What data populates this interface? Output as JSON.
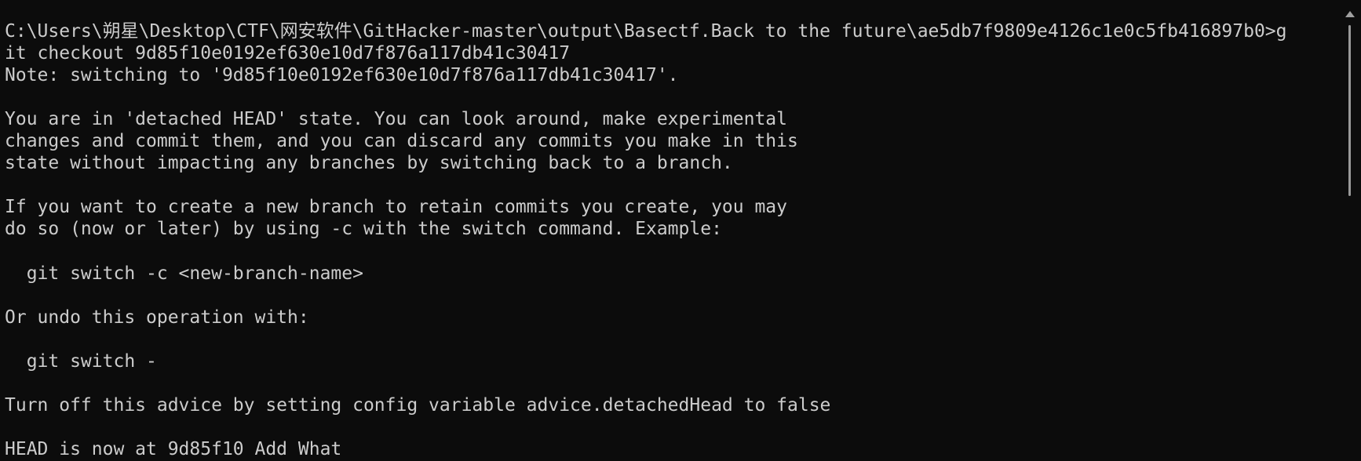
{
  "terminal": {
    "lines": [
      "C:\\Users\\朔星\\Desktop\\CTF\\网安软件\\GitHacker-master\\output\\Basectf.Back to the future\\ae5db7f9809e4126c1e0c5fb416897b0>g",
      "it checkout 9d85f10e0192ef630e10d7f876a117db41c30417",
      "Note: switching to '9d85f10e0192ef630e10d7f876a117db41c30417'.",
      "",
      "You are in 'detached HEAD' state. You can look around, make experimental",
      "changes and commit them, and you can discard any commits you make in this",
      "state without impacting any branches by switching back to a branch.",
      "",
      "If you want to create a new branch to retain commits you create, you may",
      "do so (now or later) by using -c with the switch command. Example:",
      "",
      "  git switch -c <new-branch-name>",
      "",
      "Or undo this operation with:",
      "",
      "  git switch -",
      "",
      "Turn off this advice by setting config variable advice.detachedHead to false",
      "",
      "HEAD is now at 9d85f10 Add What"
    ]
  },
  "colors": {
    "background": "#0c0c0c",
    "foreground": "#cccccc",
    "scrollbar_thumb": "#9a9a9a"
  },
  "icons": {
    "scroll_up": "triangle-up-icon"
  }
}
